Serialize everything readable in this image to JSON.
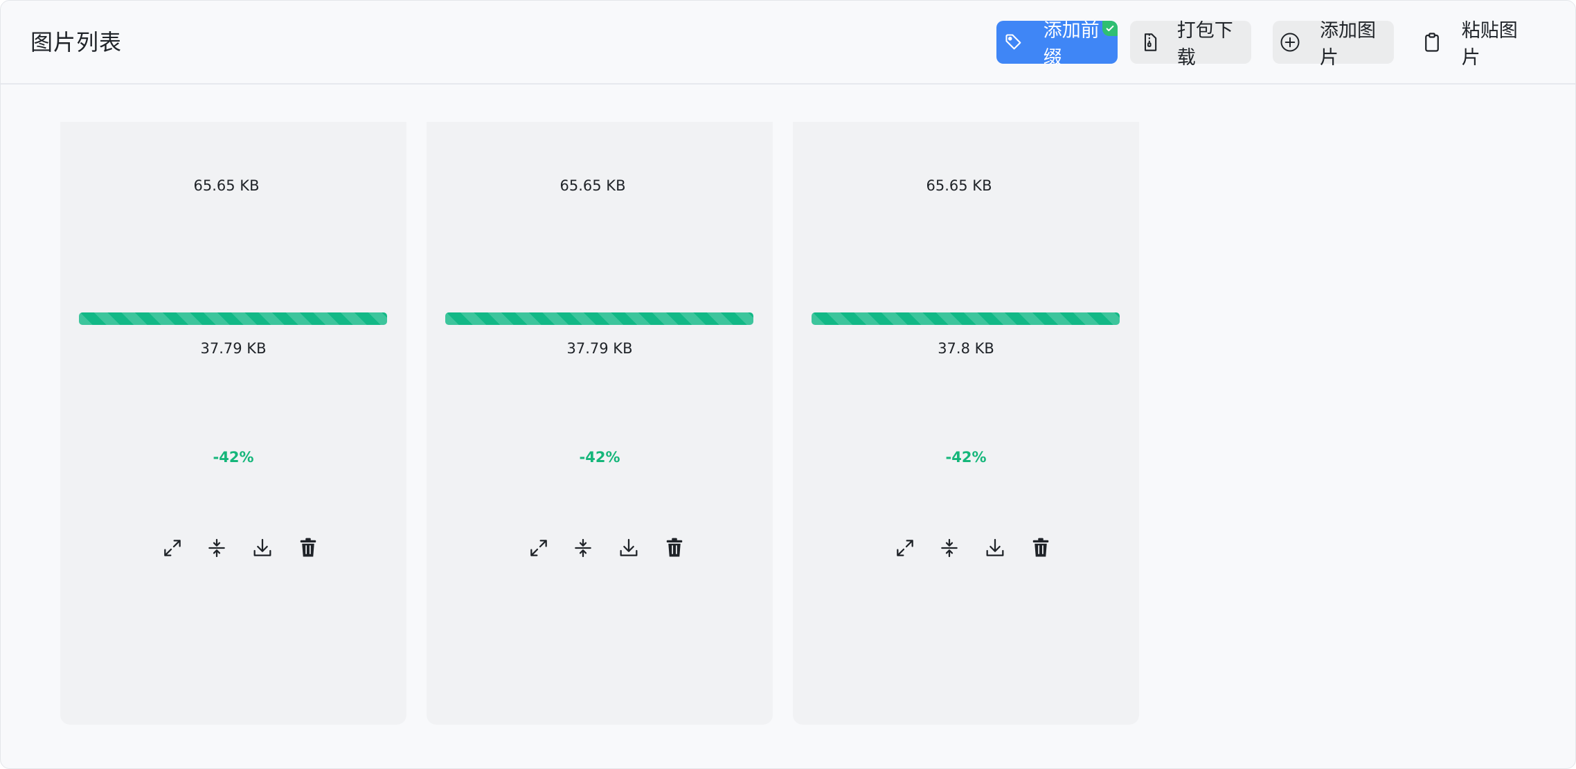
{
  "header": {
    "title": "图片列表",
    "buttons": {
      "add_prefix": {
        "label": "添加前缀",
        "icon": "tag-icon",
        "active": true,
        "accent": "#3f86f6",
        "badge_color": "#2fbf71"
      },
      "pack_download": {
        "label": "打包下载",
        "icon": "zip-file-icon"
      },
      "add_image": {
        "label": "添加图片",
        "icon": "plus-circle-icon"
      },
      "paste_image": {
        "label": "粘贴图片",
        "icon": "clipboard-icon"
      }
    }
  },
  "cards": [
    {
      "original_size": "65.65 KB",
      "compressed_size": "37.79 KB",
      "ratio": "-42%",
      "progress": 1.0
    },
    {
      "original_size": "65.65 KB",
      "compressed_size": "37.79 KB",
      "ratio": "-42%",
      "progress": 1.0
    },
    {
      "original_size": "65.65 KB",
      "compressed_size": "37.8 KB",
      "ratio": "-42%",
      "progress": 1.0
    }
  ],
  "card_actions": [
    "expand-icon",
    "compress-icon",
    "download-icon",
    "trash-icon"
  ],
  "colors": {
    "progress": "#12b886",
    "ratio_text": "#15b67a"
  }
}
